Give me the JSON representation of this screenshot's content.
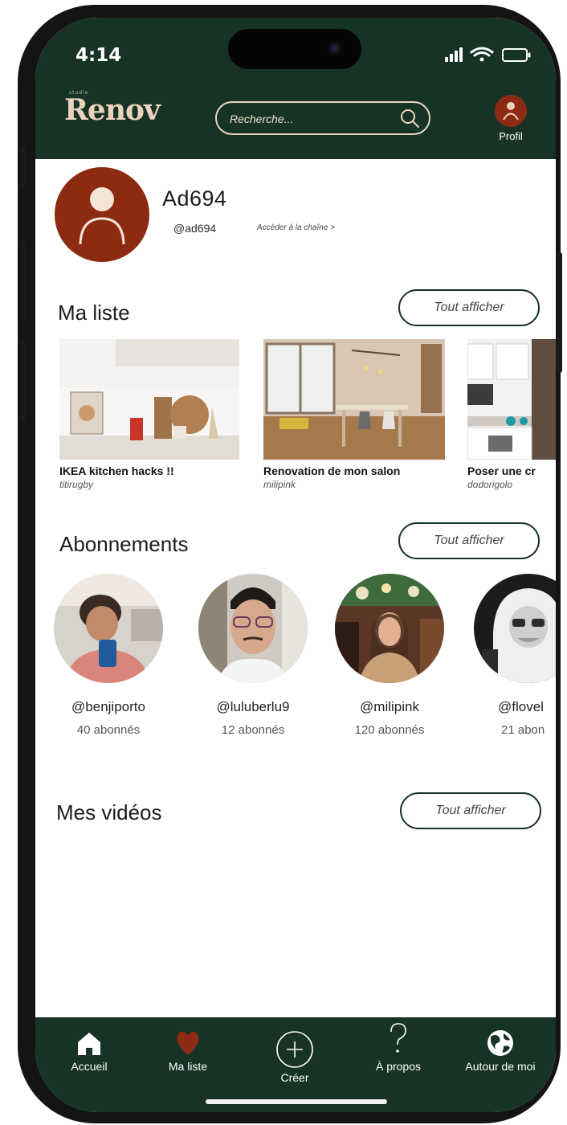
{
  "status_bar": {
    "time": "4:14"
  },
  "header": {
    "logo_small": "studio",
    "logo": "Renov",
    "search_placeholder": "Recherche...",
    "profile_label": "Profil"
  },
  "profile": {
    "name": "Ad694",
    "handle": "@ad694",
    "channel_link": "Accéder à la chaîne >"
  },
  "my_list": {
    "title": "Ma liste",
    "see_all": "Tout afficher",
    "items": [
      {
        "title": "IKEA kitchen hacks !!",
        "author": "titirugby"
      },
      {
        "title": "Renovation de mon salon",
        "author": "milipink"
      },
      {
        "title": "Poser une cr",
        "author": "dodorigolo"
      }
    ]
  },
  "subscriptions": {
    "title": "Abonnements",
    "see_all": "Tout afficher",
    "items": [
      {
        "handle": "@benjiporto",
        "followers": "40 abonnés"
      },
      {
        "handle": "@luluberlu9",
        "followers": "12 abonnés"
      },
      {
        "handle": "@milipink",
        "followers": "120 abonnés"
      },
      {
        "handle": "@flovel",
        "followers": "21 abon"
      }
    ]
  },
  "my_videos": {
    "title": "Mes vidéos",
    "see_all": "Tout afficher"
  },
  "nav": {
    "home": "Accueil",
    "my_list": "Ma liste",
    "create": "Créer",
    "about": "À propos",
    "around": "Autour de moi"
  },
  "colors": {
    "primary_green": "#163326",
    "accent_rust": "#8c2b12",
    "logo_beige": "#ecd2bc"
  }
}
